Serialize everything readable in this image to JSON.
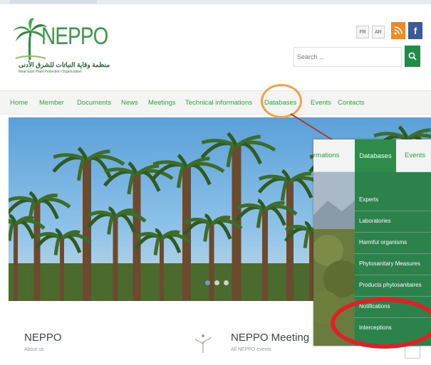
{
  "logo": {
    "brand": "NEPPO",
    "arabic": "منظمة وقاية النباتات للشرق الأدنى",
    "subtitle": "Near East Plant Protection Organization"
  },
  "header": {
    "lang_buttons": [
      "FR",
      "AR"
    ],
    "search_placeholder": "Search ..."
  },
  "nav": {
    "items": [
      "Home",
      "Member",
      "Documents",
      "News",
      "Meetings",
      "Technical informations",
      "Databases",
      "Events",
      "Contacts"
    ]
  },
  "inset": {
    "nav_items": [
      "rmations",
      "Databases",
      "Events"
    ],
    "dropdown": [
      "Experts",
      "Laboratories",
      "Harmful organisms",
      "Phytosanitary Measures",
      "Products phytosanitaires",
      "Notifications",
      "Interceptions"
    ]
  },
  "cards": [
    {
      "title": "NEPPO",
      "subtitle": "About us"
    },
    {
      "title": "NEPPO Meeting",
      "subtitle": "All NEPPO events"
    }
  ],
  "colors": {
    "brand_green": "#3a9a45",
    "dropdown_green": "#2e8b4a",
    "annotation_orange": "#f5a04a",
    "annotation_red": "#e31e24"
  }
}
